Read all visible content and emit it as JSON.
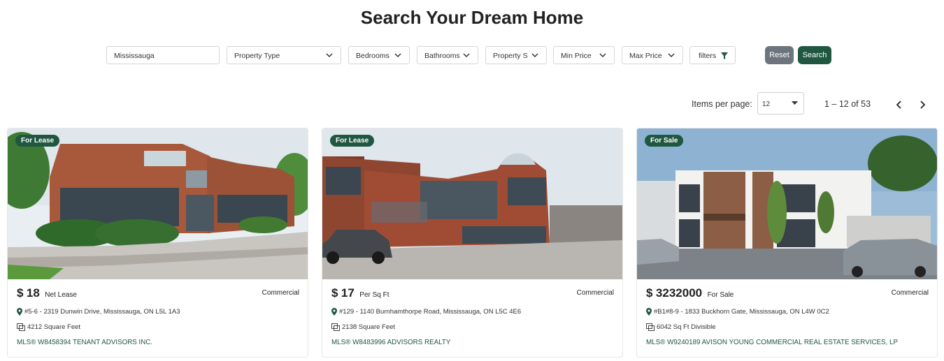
{
  "page": {
    "title": "Search Your Dream Home"
  },
  "filters": {
    "location_value": "Mississauga",
    "property_type": "Property Type",
    "bedrooms": "Bedrooms",
    "bathrooms": "Bathrooms",
    "property_status": "Property S",
    "min_price": "Min Price",
    "max_price": "Max Price",
    "filters_label": "filters",
    "reset_label": "Reset",
    "search_label": "Search"
  },
  "pagination": {
    "items_per_page_label": "Items per page:",
    "items_per_page_value": "12",
    "range_label": "1 – 12 of 53"
  },
  "listings": [
    {
      "badge": "For Lease",
      "price_symbol": "$",
      "price": "18",
      "price_unit": "Net Lease",
      "type": "Commercial",
      "address": "#5-6 - 2319 Dunwin Drive, Mississauga, ON L5L 1A3",
      "size": "4212 Square Feet",
      "mls": "MLS® W8458394 TENANT ADVISORS INC."
    },
    {
      "badge": "For Lease",
      "price_symbol": "$",
      "price": "17",
      "price_unit": "Per Sq Ft",
      "type": "Commercial",
      "address": "#129 - 1140 Burnhamthorpe Road, Mississauga, ON L5C 4E6",
      "size": "2138 Square Feet",
      "mls": "MLS® W8483996 ADVISORS REALTY"
    },
    {
      "badge": "For Sale",
      "price_symbol": "$",
      "price": "3232000",
      "price_unit": "For Sale",
      "type": "Commercial",
      "address": "#B1#8-9 - 1833 Buckhorn Gate, Mississauga, ON L4W 0C2",
      "size": "6042 Sq Ft Divisible",
      "mls": "MLS® W9240189 AVISON YOUNG COMMERCIAL REAL ESTATE SERVICES, LP"
    }
  ],
  "colors": {
    "accent": "#1f5740",
    "reset": "#6c757d",
    "text": "#222222"
  }
}
